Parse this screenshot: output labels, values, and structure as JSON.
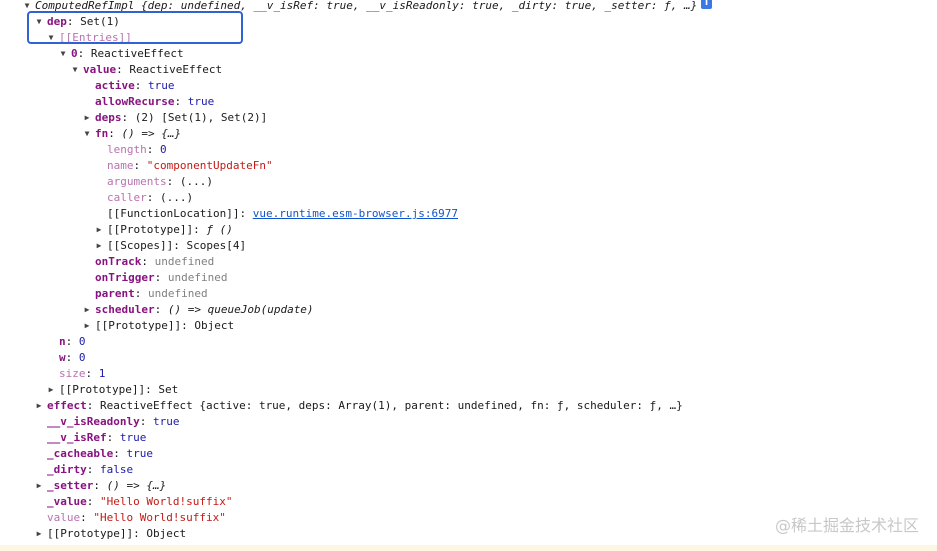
{
  "rows": {
    "root": {
      "text": "ComputedRefImpl {dep: undefined, __v_isRef: true, __v_isReadonly: true, _dirty: true, _setter: ƒ, …}",
      "info": "i"
    },
    "dep": {
      "key": "dep",
      "value": "Set(1)"
    },
    "entries": {
      "key": "[[Entries]]"
    },
    "entry0": {
      "key": "0",
      "value": "ReactiveEffect"
    },
    "value": {
      "key": "value",
      "value": "ReactiveEffect"
    },
    "active": {
      "key": "active",
      "value": "true"
    },
    "allowRecurse": {
      "key": "allowRecurse",
      "value": "true"
    },
    "deps": {
      "key": "deps",
      "value": "(2) [Set(1), Set(2)]"
    },
    "fn": {
      "key": "fn",
      "value": "() => {…}"
    },
    "length": {
      "key": "length",
      "value": "0"
    },
    "name": {
      "key": "name",
      "value": "\"componentUpdateFn\""
    },
    "arguments": {
      "key": "arguments",
      "value": "(...)"
    },
    "caller": {
      "key": "caller",
      "value": "(...)"
    },
    "functionLocation": {
      "key": "[[FunctionLocation]]",
      "value": "vue.runtime.esm-browser.js:6977"
    },
    "fnPrototype": {
      "key": "[[Prototype]]",
      "value": "ƒ ()"
    },
    "scopes": {
      "key": "[[Scopes]]",
      "value": "Scopes[4]"
    },
    "onTrack": {
      "key": "onTrack",
      "value": "undefined"
    },
    "onTrigger": {
      "key": "onTrigger",
      "value": "undefined"
    },
    "parent": {
      "key": "parent",
      "value": "undefined"
    },
    "scheduler": {
      "key": "scheduler",
      "value": "() => queueJob(update)"
    },
    "effectPrototype": {
      "key": "[[Prototype]]",
      "value": "Object"
    },
    "n": {
      "key": "n",
      "value": "0"
    },
    "w": {
      "key": "w",
      "value": "0"
    },
    "size": {
      "key": "size",
      "value": "1"
    },
    "setPrototype": {
      "key": "[[Prototype]]",
      "value": "Set"
    },
    "effect": {
      "key": "effect",
      "value": "ReactiveEffect {active: true, deps: Array(1), parent: undefined, fn: ƒ, scheduler: ƒ, …}"
    },
    "isReadonly": {
      "key": "__v_isReadonly",
      "value": "true"
    },
    "isRef": {
      "key": "__v_isRef",
      "value": "true"
    },
    "cacheable": {
      "key": "_cacheable",
      "value": "true"
    },
    "dirty": {
      "key": "_dirty",
      "value": "false"
    },
    "setter": {
      "key": "_setter",
      "value": "() => {…}"
    },
    "privValue": {
      "key": "_value",
      "value": "\"Hello World!suffix\""
    },
    "valueGetter": {
      "key": "value",
      "value": "\"Hello World!suffix\""
    },
    "rootPrototype": {
      "key": "[[Prototype]]",
      "value": "Object"
    }
  },
  "watermark": "@稀土掘金技术社区",
  "colors": {
    "highlight": "#2f62d6",
    "key": "#881280",
    "string": "#c41a16",
    "bool": "#1a1aa6",
    "link": "#1155cc"
  }
}
